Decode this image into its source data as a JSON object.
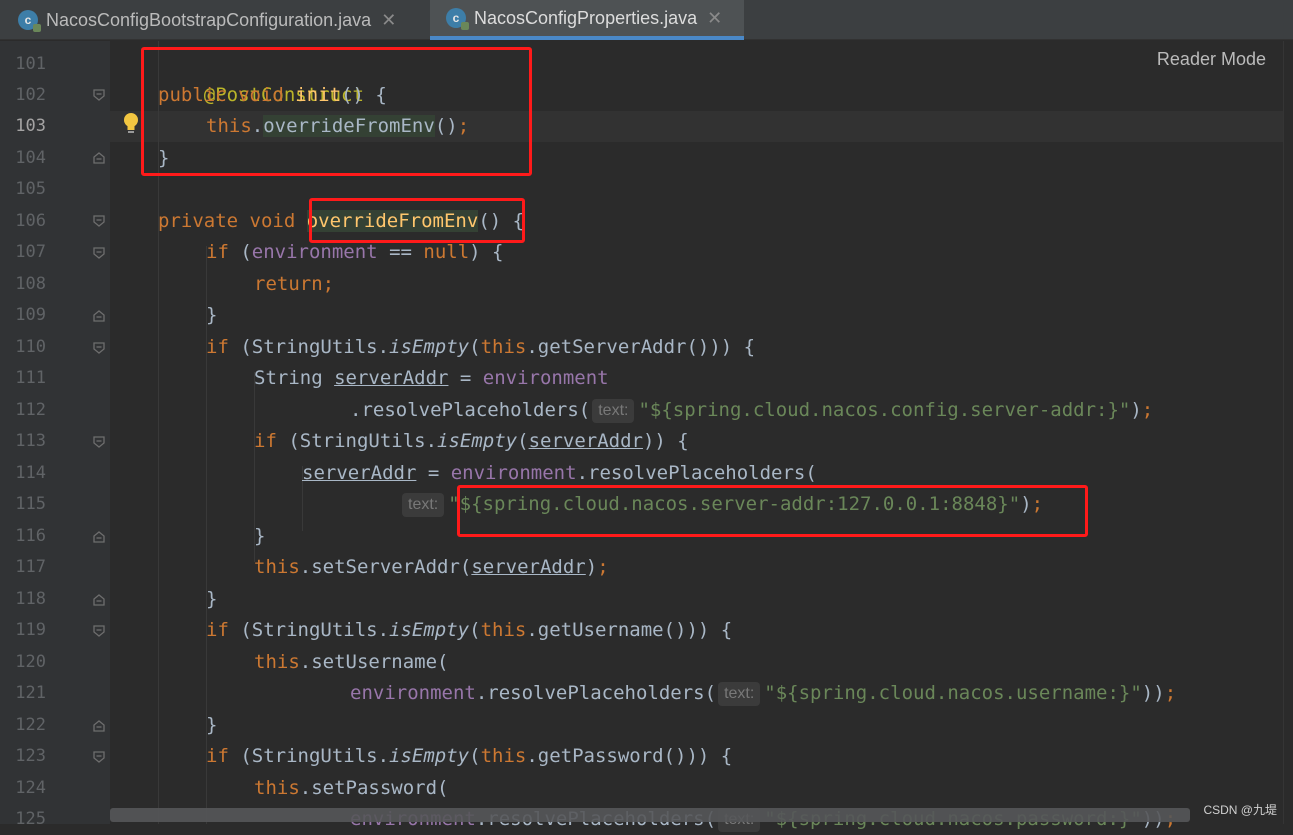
{
  "tabs": [
    {
      "label": "NacosConfigBootstrapConfiguration.java",
      "icon": "class-icon",
      "active": false
    },
    {
      "label": "NacosConfigProperties.java",
      "icon": "class-icon",
      "active": true
    }
  ],
  "tab_close_symbol": "✕",
  "class_icon_letter": "c",
  "reader_mode_label": "Reader Mode",
  "watermark": "CSDN @九堤",
  "current_line": 103,
  "line_numbers": [
    "101",
    "102",
    "103",
    "104",
    "105",
    "106",
    "107",
    "108",
    "109",
    "110",
    "111",
    "112",
    "113",
    "114",
    "115",
    "116",
    "117",
    "118",
    "119",
    "120",
    "121",
    "122",
    "123",
    "124",
    "125"
  ],
  "code": {
    "l101": "@PostConstruct",
    "l102": {
      "kw": "public void ",
      "fn": "init",
      "rest": "() {"
    },
    "l103": {
      "kw": "this",
      "dot": ".",
      "call": "overrideFromEnv",
      "rest": "()",
      "semi": ";"
    },
    "l104": "}",
    "l106": {
      "kw": "private void ",
      "fn": "overrideFromEnv",
      "paren": "()",
      "rest": " {"
    },
    "l107": {
      "kw": "if",
      "p1": " (",
      "fld": "environment",
      "op": " == ",
      "kw2": "null",
      "p2": ") {"
    },
    "l108": "return;",
    "l109": "}",
    "l110": {
      "kw": "if",
      "p1": " (StringUtils.",
      "it": "isEmpty",
      "p2": "(",
      "kw2": "this",
      "p3": ".getServerAddr())) {"
    },
    "l111": {
      "a": "String ",
      "var": "serverAddr",
      "b": " = ",
      "fld": "environment"
    },
    "l112": {
      "a": ".resolvePlaceholders(",
      "hint": "text:",
      "str": "\"${spring.cloud.nacos.config.server-addr:}\"",
      "b": ")",
      "semi": ";"
    },
    "l113": {
      "kw": "if",
      "p1": " (StringUtils.",
      "it": "isEmpty",
      "p2": "(",
      "var": "serverAddr",
      "p3": ")) {"
    },
    "l114": {
      "var": "serverAddr",
      "a": " = ",
      "fld": "environment",
      "b": ".resolvePlaceholders("
    },
    "l115": {
      "hint": "text:",
      "str": "\"${spring.cloud.nacos.server-addr:127.0.0.1:8848}\"",
      "b": ")",
      "semi": ";"
    },
    "l116": "}",
    "l117": {
      "kw": "this",
      "a": ".setServerAddr(",
      "var": "serverAddr",
      "b": ")",
      "semi": ";"
    },
    "l118": "}",
    "l119": {
      "kw": "if",
      "p1": " (StringUtils.",
      "it": "isEmpty",
      "p2": "(",
      "kw2": "this",
      "p3": ".getUsername())) {"
    },
    "l120": {
      "kw": "this",
      "a": ".setUsername("
    },
    "l121": {
      "fld": "environment",
      "a": ".resolvePlaceholders(",
      "hint": "text:",
      "str": "\"${spring.cloud.nacos.username:}\"",
      "b": "))",
      "semi": ";"
    },
    "l122": "}",
    "l123": {
      "kw": "if",
      "p1": " (StringUtils.",
      "it": "isEmpty",
      "p2": "(",
      "kw2": "this",
      "p3": ".getPassword())) {"
    },
    "l124": {
      "kw": "this",
      "a": ".setPassword("
    },
    "l125": {
      "fld": "environment",
      "a": ".resolvePlaceholders(",
      "hint": "text:",
      "str": "\"${spring.cloud.nacos.password:}\"",
      "b": "))",
      "semi": ";"
    }
  },
  "colors": {
    "editor_bg": "#2b2b2b",
    "gutter_bg": "#313335",
    "keyword": "#cc7832",
    "annotation": "#bbb529",
    "method_decl": "#ffc66d",
    "field": "#9876aa",
    "string": "#6a8759",
    "default_text": "#a9b7c6",
    "highlight_box": "#ff1a1a",
    "active_tab_underline": "#4a88c7"
  }
}
